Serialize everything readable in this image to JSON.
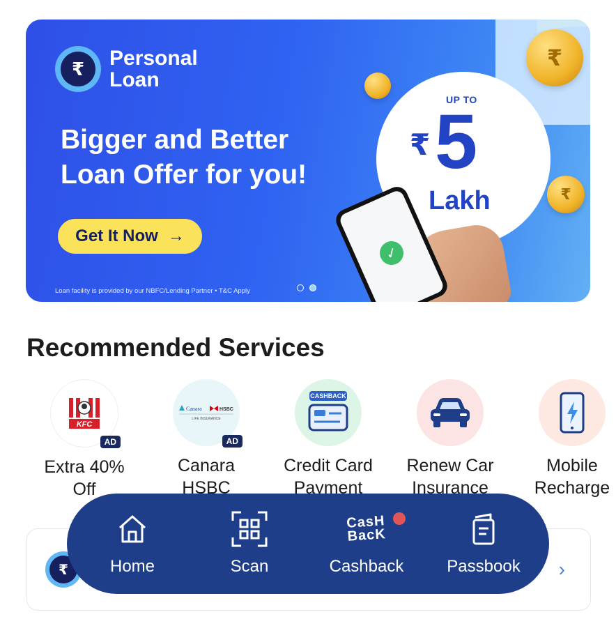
{
  "banner": {
    "brand_line1": "Personal",
    "brand_line2": "Loan",
    "headline_line1": "Bigger and Better",
    "headline_line2": "Loan Offer for you!",
    "cta_label": "Get It Now",
    "cta_arrow": "→",
    "disclaimer": "Loan facility is provided by our NBFC/Lending Partner • T&C Apply",
    "offer_prefix": "UP TO",
    "offer_currency": "₹",
    "offer_amount": "5",
    "offer_unit": "Lakh",
    "rupee_symbol": "₹",
    "carousel": {
      "count": 2,
      "active_index": 1
    }
  },
  "recommended": {
    "title": "Recommended Services",
    "items": [
      {
        "label_line1": "Extra 40%",
        "label_line2": "Off",
        "badge": "AD",
        "icon": "kfc-logo-icon",
        "logo_text": "KFC"
      },
      {
        "label_line1": "Canara",
        "label_line2": "HSBC",
        "badge": "AD",
        "icon": "canara-hsbc-logo-icon",
        "logo_text_1": "Canara",
        "logo_text_2": "HSBC",
        "logo_text_3": "LIFE INSURANCE"
      },
      {
        "label_line1": "Credit Card",
        "label_line2": "Payment",
        "badge": "",
        "icon": "credit-card-cashback-icon",
        "logo_text": "CASHBACK"
      },
      {
        "label_line1": "Renew Car",
        "label_line2": "Insurance",
        "badge": "",
        "icon": "car-icon"
      },
      {
        "label_line1": "Mobile",
        "label_line2": "Recharge",
        "badge": "",
        "icon": "mobile-recharge-icon"
      }
    ]
  },
  "info_card": {
    "icon_symbol": "₹",
    "chevron": "›"
  },
  "bottom_nav": {
    "items": [
      {
        "label": "Home",
        "icon": "home-icon"
      },
      {
        "label": "Scan",
        "icon": "scan-qr-icon"
      },
      {
        "label": "Cashback",
        "icon": "cashback-icon",
        "icon_text_1": "CasH",
        "icon_text_2": "BacK",
        "has_notification": true
      },
      {
        "label": "Passbook",
        "icon": "passbook-icon"
      }
    ]
  },
  "colors": {
    "banner_blue": "#2f4fe6",
    "cta_yellow": "#fbe25b",
    "nav_navy": "#1f3e89",
    "offer_blue": "#2243c4",
    "notification_red": "#e05656"
  }
}
